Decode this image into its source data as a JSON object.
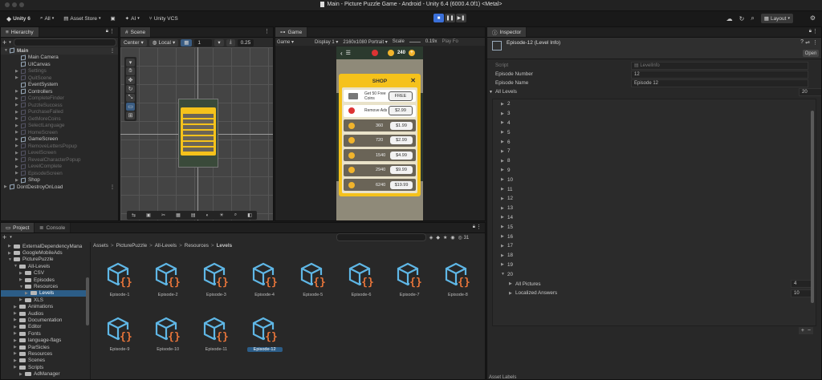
{
  "window_title": "Main - Picture Puzzle Game - Android - Unity 6.4 (6000.4.0f1) <Metal>",
  "toolbar": {
    "account": "Unity 6",
    "all": "All",
    "asset_store": "Asset Store",
    "ai": "AI",
    "vcs": "Unity VCS",
    "layout": "Layout"
  },
  "hierarchy": {
    "title": "Hierarchy",
    "items": [
      {
        "label": "Main",
        "dim": false,
        "indent": 0,
        "bold": true
      },
      {
        "label": "Main Camera",
        "dim": false,
        "indent": 1
      },
      {
        "label": "UICanvas",
        "dim": false,
        "indent": 1
      },
      {
        "label": "Settings",
        "dim": true,
        "indent": 1
      },
      {
        "label": "QuitScene",
        "dim": true,
        "indent": 1
      },
      {
        "label": "EventSystem",
        "dim": false,
        "indent": 1
      },
      {
        "label": "Controllers",
        "dim": false,
        "indent": 1
      },
      {
        "label": "CompleteFinder",
        "dim": true,
        "indent": 1
      },
      {
        "label": "PuzzleSuccess",
        "dim": true,
        "indent": 1
      },
      {
        "label": "PurchaseFailed",
        "dim": true,
        "indent": 1
      },
      {
        "label": "GetMoreCoins",
        "dim": true,
        "indent": 1
      },
      {
        "label": "SelectLanguage",
        "dim": true,
        "indent": 1
      },
      {
        "label": "HomeScreen",
        "dim": true,
        "indent": 1
      },
      {
        "label": "GameScreen",
        "dim": false,
        "indent": 1
      },
      {
        "label": "RemoveLettersPopup",
        "dim": true,
        "indent": 1
      },
      {
        "label": "LevelScreen",
        "dim": true,
        "indent": 1
      },
      {
        "label": "RevealCharacterPopup",
        "dim": true,
        "indent": 1
      },
      {
        "label": "LevelComplete",
        "dim": true,
        "indent": 1
      },
      {
        "label": "EpisodeScreen",
        "dim": true,
        "indent": 1
      },
      {
        "label": "Shop",
        "dim": false,
        "indent": 1
      },
      {
        "label": "DontDestroyOnLoad",
        "dim": false,
        "indent": 0
      }
    ]
  },
  "scene": {
    "title": "Scene",
    "pivot": "Center",
    "space": "Local",
    "grid_value": "1",
    "snap_value": "0.25"
  },
  "game": {
    "title": "Game",
    "display_mode": "Game",
    "display": "Display 1",
    "resolution": "2160x1080 Portrait",
    "scale_label": "Scale",
    "scale_value": "0.19x",
    "play_focused": "Play Fo",
    "coins": "240",
    "shop": {
      "title": "SHOP",
      "rows": [
        {
          "label": "Get 50 Free Coins",
          "price": "FREE"
        },
        {
          "label": "Remove Ads",
          "price": "$2.99"
        },
        {
          "label": "360",
          "price": "$1.99"
        },
        {
          "label": "720",
          "price": "$2.99"
        },
        {
          "label": "1540",
          "price": "$4.99"
        },
        {
          "label": "2940",
          "price": "$9.99"
        },
        {
          "label": "6240",
          "price": "$19.99"
        }
      ]
    }
  },
  "project": {
    "tabs": [
      "Project",
      "Console"
    ],
    "tree": [
      {
        "label": "ExternalDependencyMana",
        "indent": 1
      },
      {
        "label": "GoogleMobileAds",
        "indent": 1
      },
      {
        "label": "PicturePuzzle",
        "indent": 1
      },
      {
        "label": "All-Levels",
        "indent": 2
      },
      {
        "label": "CSV",
        "indent": 3
      },
      {
        "label": "Episodes",
        "indent": 3
      },
      {
        "label": "Resources",
        "indent": 3
      },
      {
        "label": "Levels",
        "indent": 4,
        "selected": true
      },
      {
        "label": "XLS",
        "indent": 3
      },
      {
        "label": "Animations",
        "indent": 2
      },
      {
        "label": "Audios",
        "indent": 2
      },
      {
        "label": "Documentation",
        "indent": 2
      },
      {
        "label": "Editor",
        "indent": 2
      },
      {
        "label": "Fonts",
        "indent": 2
      },
      {
        "label": "language-flags",
        "indent": 2
      },
      {
        "label": "ParSicles",
        "indent": 2
      },
      {
        "label": "Resources",
        "indent": 2
      },
      {
        "label": "Scenes",
        "indent": 2
      },
      {
        "label": "Scripts",
        "indent": 2
      },
      {
        "label": "AdManager",
        "indent": 3
      }
    ],
    "breadcrumb": [
      "Assets",
      "PicturePuzzle",
      "All-Levels",
      "Resources",
      "Levels"
    ],
    "count": "31",
    "assets": [
      "Episode-1",
      "Episode-2",
      "Episode-3",
      "Episode-4",
      "Episode-5",
      "Episode-6",
      "Episode-7",
      "Episode-8",
      "Episode-9",
      "Episode-10",
      "Episode-11",
      "Episode-12"
    ],
    "selected_asset": "Episode-12"
  },
  "inspector": {
    "title": "Inspector",
    "object_title": "Episode-12 (Level Info)",
    "open_label": "Open",
    "script_label": "Script",
    "script_value": "LevelInfo",
    "episode_number_label": "Episode Number",
    "episode_number_value": "12",
    "episode_name_label": "Episode Name",
    "episode_name_value": "Episode 12",
    "all_levels_label": "All Levels",
    "all_levels_count": "20",
    "levels": [
      "2",
      "3",
      "4",
      "5",
      "6",
      "7",
      "8",
      "9",
      "10",
      "11",
      "12",
      "13",
      "14",
      "15",
      "16",
      "17",
      "18",
      "19",
      "20"
    ],
    "sub_items": [
      {
        "label": "All Pictures",
        "value": "4"
      },
      {
        "label": "Localized Answers",
        "value": "10"
      }
    ],
    "asset_labels": "Asset Labels"
  },
  "colors": {
    "accent_blue": "#2c5d87",
    "play_button": "#3a6fd8",
    "shop_yellow": "#f5c21b",
    "asset_icon_blue": "#5fb7e6",
    "asset_icon_orange": "#e8753a"
  }
}
